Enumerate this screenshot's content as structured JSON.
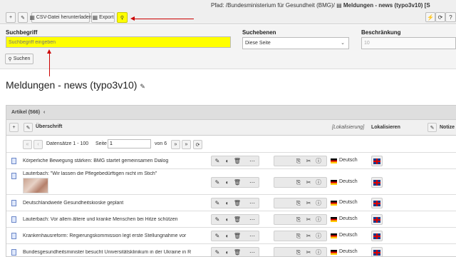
{
  "toolbar": {
    "csv_label": "CSV-Datei herunterladen",
    "export_label": "Export",
    "highlight_color": "#ffff00"
  },
  "path": {
    "prefix": "Pfad: /Bundesministerium für Gesundheit (BMG)/",
    "page": "Meldungen - news (typo3v10) [S"
  },
  "search": {
    "term_label": "Suchbegriff",
    "term_placeholder": "Suchbegriff eingeben",
    "levels_label": "Suchebenen",
    "levels_value": "Diese Seite",
    "limit_label": "Beschränkung",
    "limit_value": "10",
    "submit_label": "Suchen"
  },
  "page_title": "Meldungen - news (typo3v10)",
  "table": {
    "title": "Artikel (566)",
    "col_title": "Überschrift",
    "col_localization": "[Lokalisierung]",
    "col_localize": "Lokalisieren",
    "col_notes": "Notize",
    "pager": {
      "records": "Datensätze 1 - 100",
      "page_label": "Seite",
      "page_value": "1",
      "of_label": "von 6"
    },
    "rows": [
      {
        "title": "Körperliche Bewegung stärken: BMG startet gemeinsamen Dialog",
        "lang": "Deutsch",
        "has_thumb": false
      },
      {
        "title": "Lauterbach: \"Wir lassen die Pflegebedürftigen nicht im Stich\"",
        "lang": "Deutsch",
        "has_thumb": true
      },
      {
        "title": "Deutschlandweite Gesundheitskioske geplant",
        "lang": "Deutsch",
        "has_thumb": false
      },
      {
        "title": "Lauterbach: Vor allem ältere und kranke Menschen bei Hitze schützen",
        "lang": "Deutsch",
        "has_thumb": false
      },
      {
        "title": "Krankenhausreform: Regierungskommission legt erste Stellungnahme vor",
        "lang": "Deutsch",
        "has_thumb": false
      },
      {
        "title": "Bundesgesundheitsminister besucht Universitätsklinikum in der Ukraine in R",
        "lang": "Deutsch",
        "has_thumb": false
      }
    ]
  }
}
